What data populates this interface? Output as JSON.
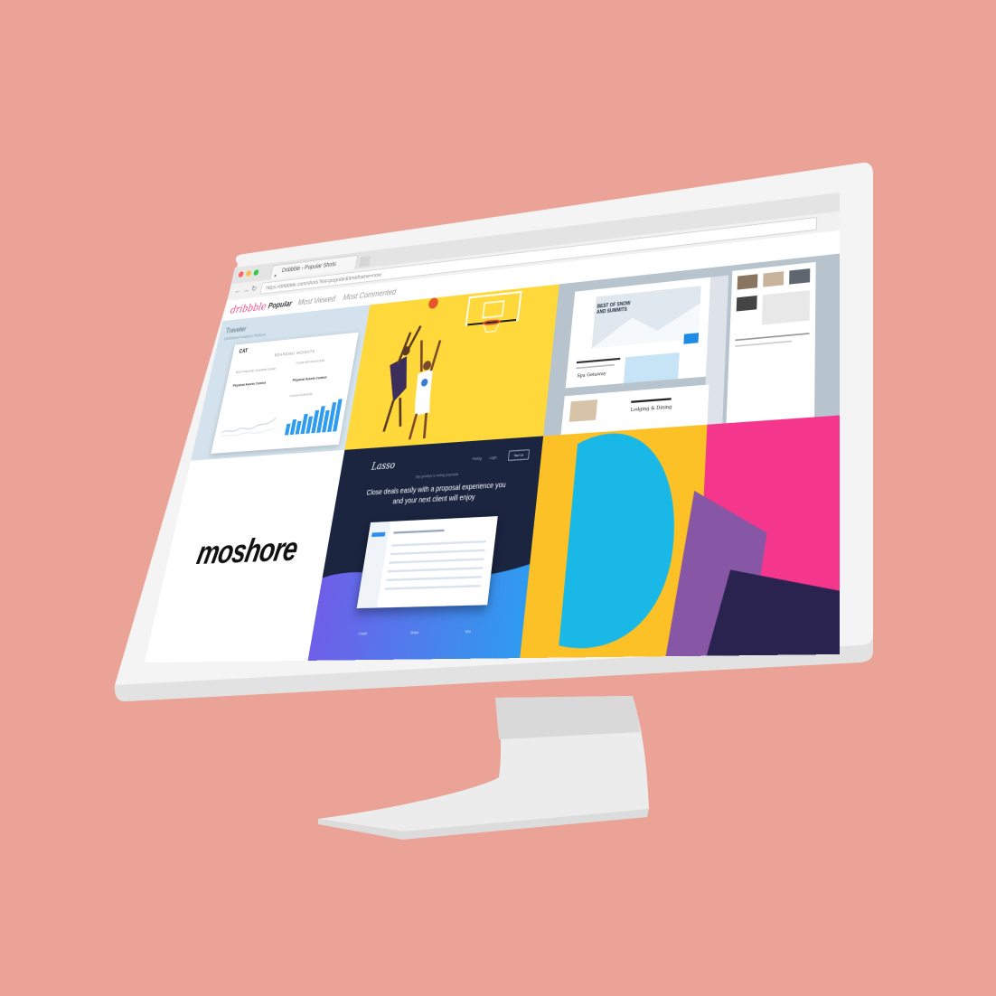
{
  "browser": {
    "tab_title": "Dribbble - Popular Shots",
    "url": "https://dribbble.com/shots?list=popular&timeframe=now",
    "lights": [
      "#fc615d",
      "#fdbc40",
      "#34c84a"
    ]
  },
  "dribbble_nav": {
    "brand": "dribbble",
    "links": [
      "Popular",
      "Most Viewed",
      "Most Commented"
    ]
  },
  "shots": {
    "traveler": {
      "title": "Traveler",
      "subtitle": "Dashboard Analytics Platform",
      "logo": "CAT",
      "card_title": "BOARDING INSIGHTS",
      "label_a": "Most Frequently Completed Course",
      "value_a": "Physical Assets Control",
      "label_b": "Course with most Enrolls",
      "value_b": "Physical Assets Control",
      "label_c": "Course Enrollments",
      "bars": [
        22,
        30,
        26,
        40,
        34,
        46,
        52,
        44,
        58,
        64
      ]
    },
    "moshore": {
      "wordmark": "moshore"
    },
    "lasso": {
      "logo": "Lasso",
      "nav": [
        "Pricing",
        "Login"
      ],
      "signup": "Sign Up",
      "tagline": "Say goodbye to writing proposals",
      "headline": "Close deals easily with a proposal experience you and your next client will enjoy",
      "columns": [
        "Create",
        "Share",
        "Win"
      ]
    },
    "travel_site": {
      "hero": "BEST OF SNOW AND SUMMITS",
      "section_a": "Spa Getaway",
      "section_b": "Lodging & Dining"
    }
  }
}
